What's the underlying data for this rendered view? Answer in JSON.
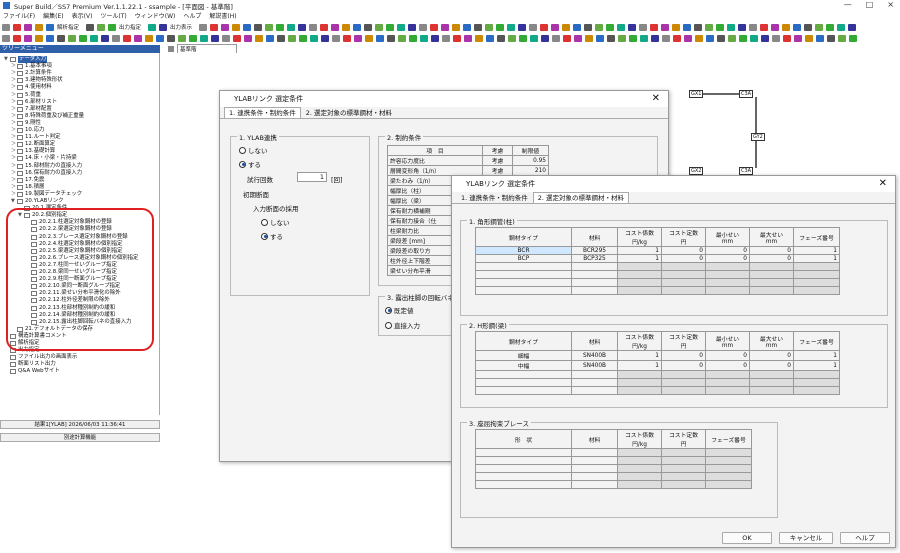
{
  "app": {
    "title": "Super Build／SS7 Premium  Ver.1.1.22.1 - ssample - [平面図 - 基準階]",
    "win_controls": [
      "—",
      "□",
      "×"
    ]
  },
  "menu": [
    "ファイル(F)",
    "編集(E)",
    "表示(V)",
    "ツール(T)",
    "ウィンドウ(W)",
    "ヘルプ",
    "解説書(H)"
  ],
  "toolbar": {
    "label1": "解析指定",
    "label2": "出力指定",
    "label3": "出力表示",
    "floor_select": "基準階"
  },
  "tree": {
    "header": "ツリーメニュー",
    "items": [
      {
        "d": 0,
        "t": "データ入力",
        "sel": true,
        "e": "▼"
      },
      {
        "d": 1,
        "t": "1.基本事項",
        "e": "＞"
      },
      {
        "d": 1,
        "t": "2.計算条件",
        "e": "＞"
      },
      {
        "d": 1,
        "t": "3.建物特殊形状",
        "e": "＞"
      },
      {
        "d": 1,
        "t": "4.使用材料",
        "e": "＞"
      },
      {
        "d": 1,
        "t": "5.荷重",
        "e": "＞"
      },
      {
        "d": 1,
        "t": "6.部材リスト",
        "e": "＞"
      },
      {
        "d": 1,
        "t": "7.部材配置",
        "e": "＞"
      },
      {
        "d": 1,
        "t": "8.特殊荷重及び補正重量",
        "e": "＞"
      },
      {
        "d": 1,
        "t": "9.剛性",
        "e": "＞"
      },
      {
        "d": 1,
        "t": "10.応力",
        "e": "＞"
      },
      {
        "d": 1,
        "t": "11.ルート判定",
        "e": "＞"
      },
      {
        "d": 1,
        "t": "12.断面算定",
        "e": "＞"
      },
      {
        "d": 1,
        "t": "13.基礎計算",
        "e": "＞"
      },
      {
        "d": 1,
        "t": "14.床・小梁・片持梁",
        "e": "＞"
      },
      {
        "d": 1,
        "t": "15.部材耐力の直接入力",
        "e": "＞"
      },
      {
        "d": 1,
        "t": "16.保有耐力の直接入力",
        "e": "＞"
      },
      {
        "d": 1,
        "t": "17.免震",
        "e": "＞"
      },
      {
        "d": 1,
        "t": "18.積層",
        "e": "＞"
      },
      {
        "d": 1,
        "t": "19.製図データチェック",
        "e": "＞"
      },
      {
        "d": 1,
        "t": "20.YLABリンク",
        "e": "▼"
      },
      {
        "d": 2,
        "t": "20.1.選定条件",
        "e": ""
      },
      {
        "d": 2,
        "t": "20.2.個別指定",
        "e": "▼"
      },
      {
        "d": 3,
        "t": "20.2.1.柱選定対象鋼材の登録",
        "e": ""
      },
      {
        "d": 3,
        "t": "20.2.2.梁選定対象鋼材の登録",
        "e": ""
      },
      {
        "d": 3,
        "t": "20.2.3.ブレース選定対象鋼材の登録",
        "e": ""
      },
      {
        "d": 3,
        "t": "20.2.4.柱選定対象鋼材の個別指定",
        "e": ""
      },
      {
        "d": 3,
        "t": "20.2.5.梁選定対象鋼材の個別指定",
        "e": ""
      },
      {
        "d": 3,
        "t": "20.2.6.ブレース選定対象鋼材の個別指定",
        "e": ""
      },
      {
        "d": 3,
        "t": "20.2.7.柱同一せいグループ指定",
        "e": ""
      },
      {
        "d": 3,
        "t": "20.2.8.梁同一せいグループ指定",
        "e": ""
      },
      {
        "d": 3,
        "t": "20.2.9.柱同一断面グループ指定",
        "e": ""
      },
      {
        "d": 3,
        "t": "20.2.10.梁同一断面グループ指定",
        "e": ""
      },
      {
        "d": 3,
        "t": "20.2.11.梁せい分布平滑化の除外",
        "e": ""
      },
      {
        "d": 3,
        "t": "20.2.12.柱外径差制限の除外",
        "e": ""
      },
      {
        "d": 3,
        "t": "20.2.13.柱部材種別制約の緩和",
        "e": ""
      },
      {
        "d": 3,
        "t": "20.2.14.梁部材種別制約の緩和",
        "e": ""
      },
      {
        "d": 3,
        "t": "20.2.15.露出柱脚回転バネの直接入力",
        "e": ""
      },
      {
        "d": 1,
        "t": "21.デフォルトデータの保存",
        "e": ""
      },
      {
        "d": 0,
        "t": "構造計算書コメント",
        "e": ""
      },
      {
        "d": 0,
        "t": "解析指定",
        "e": ""
      },
      {
        "d": 0,
        "t": "出力指定",
        "e": ""
      },
      {
        "d": 0,
        "t": "ファイル出力の画面表示",
        "e": ""
      },
      {
        "d": 0,
        "t": "断面リスト出力",
        "e": ""
      },
      {
        "d": 0,
        "t": "Q&A Webサイト",
        "e": ""
      }
    ],
    "status": "結果1[YLAB] 2026/06/03 11:36:41",
    "button": "別途計算機能"
  },
  "plan": {
    "nodes": [
      "GX1",
      "C3A",
      "GX2",
      "C3A",
      "GY2"
    ]
  },
  "dlg1": {
    "title": "YLABリンク 選定条件",
    "tabs": [
      "1. 連携条件・制約条件",
      "2. 選定対象の標準鋼材・材料"
    ],
    "g1": {
      "label": "1. YLAB連携",
      "opt_off": "しない",
      "opt_on": "する",
      "trial_label": "試行回数",
      "trial_value": "1",
      "trial_unit": "[回]",
      "init_label": "初期断面",
      "adopt_label": "入力断面の採用",
      "adopt_off": "しない",
      "adopt_on": "する"
    },
    "g2": {
      "label": "2. 制約条件",
      "headers": [
        "項　目",
        "考慮",
        "制限値"
      ],
      "rows": [
        [
          "許容応力度比",
          "考慮",
          "0.95"
        ],
        [
          "層間変形角（1/n）",
          "考慮",
          "210"
        ],
        [
          "梁たわみ（1/n）",
          "",
          ""
        ],
        [
          "幅厚比（柱）",
          "",
          ""
        ],
        [
          "幅厚比（梁）",
          "",
          ""
        ],
        [
          "保有耐力横補剛",
          "",
          ""
        ],
        [
          "保有耐力接合（仕",
          "",
          ""
        ],
        [
          "柱梁耐力比",
          "",
          ""
        ],
        [
          "梁段差 [mm]",
          "",
          ""
        ],
        [
          "梁段差の取り方",
          "",
          ""
        ],
        [
          "柱外径上下階差",
          "",
          ""
        ],
        [
          "梁せい分布平滑",
          "",
          ""
        ]
      ]
    },
    "g3": {
      "label": "3. 露出柱脚の回転バネ",
      "opt1": "既定値",
      "opt2": "直接入力"
    }
  },
  "dlg2": {
    "title": "YLABリンク 選定条件",
    "tabs": [
      "1. 連携条件・制約条件",
      "2. 選定対象の標準鋼材・材料"
    ],
    "g1": {
      "label": "1. 角形鋼管(柱)",
      "headers": [
        "鋼材タイプ",
        "材料",
        "コスト係数\n円/kg",
        "コスト定数\n円",
        "最小せい\nmm",
        "最大せい\nmm",
        "フェーズ番号"
      ],
      "rows": [
        [
          "BCR",
          "BCR295",
          "1",
          "0",
          "0",
          "0",
          "1"
        ],
        [
          "BCP",
          "BCP325",
          "1",
          "0",
          "0",
          "0",
          "1"
        ]
      ]
    },
    "g2": {
      "label": "2. H形鋼(梁)",
      "headers": [
        "鋼材タイプ",
        "材料",
        "コスト係数\n円/kg",
        "コスト定数\n円",
        "最小せい\nmm",
        "最大せい\nmm",
        "フェーズ番号"
      ],
      "rows": [
        [
          "細幅",
          "SN400B",
          "1",
          "0",
          "0",
          "0",
          "1"
        ],
        [
          "中幅",
          "SN400B",
          "1",
          "0",
          "0",
          "0",
          "1"
        ]
      ]
    },
    "g3": {
      "label": "3. 座屈拘束ブレース",
      "headers": [
        "形　状",
        "材料",
        "コスト係数\n円/kg",
        "コスト定数\n円",
        "フェーズ番号"
      ]
    },
    "ok": "OK",
    "cancel": "キャンセル",
    "help": "ヘルプ"
  },
  "colors": {
    "accent": "#2f5fa8",
    "highlight": "#e02020",
    "select_cell": "#cfe8ff"
  }
}
